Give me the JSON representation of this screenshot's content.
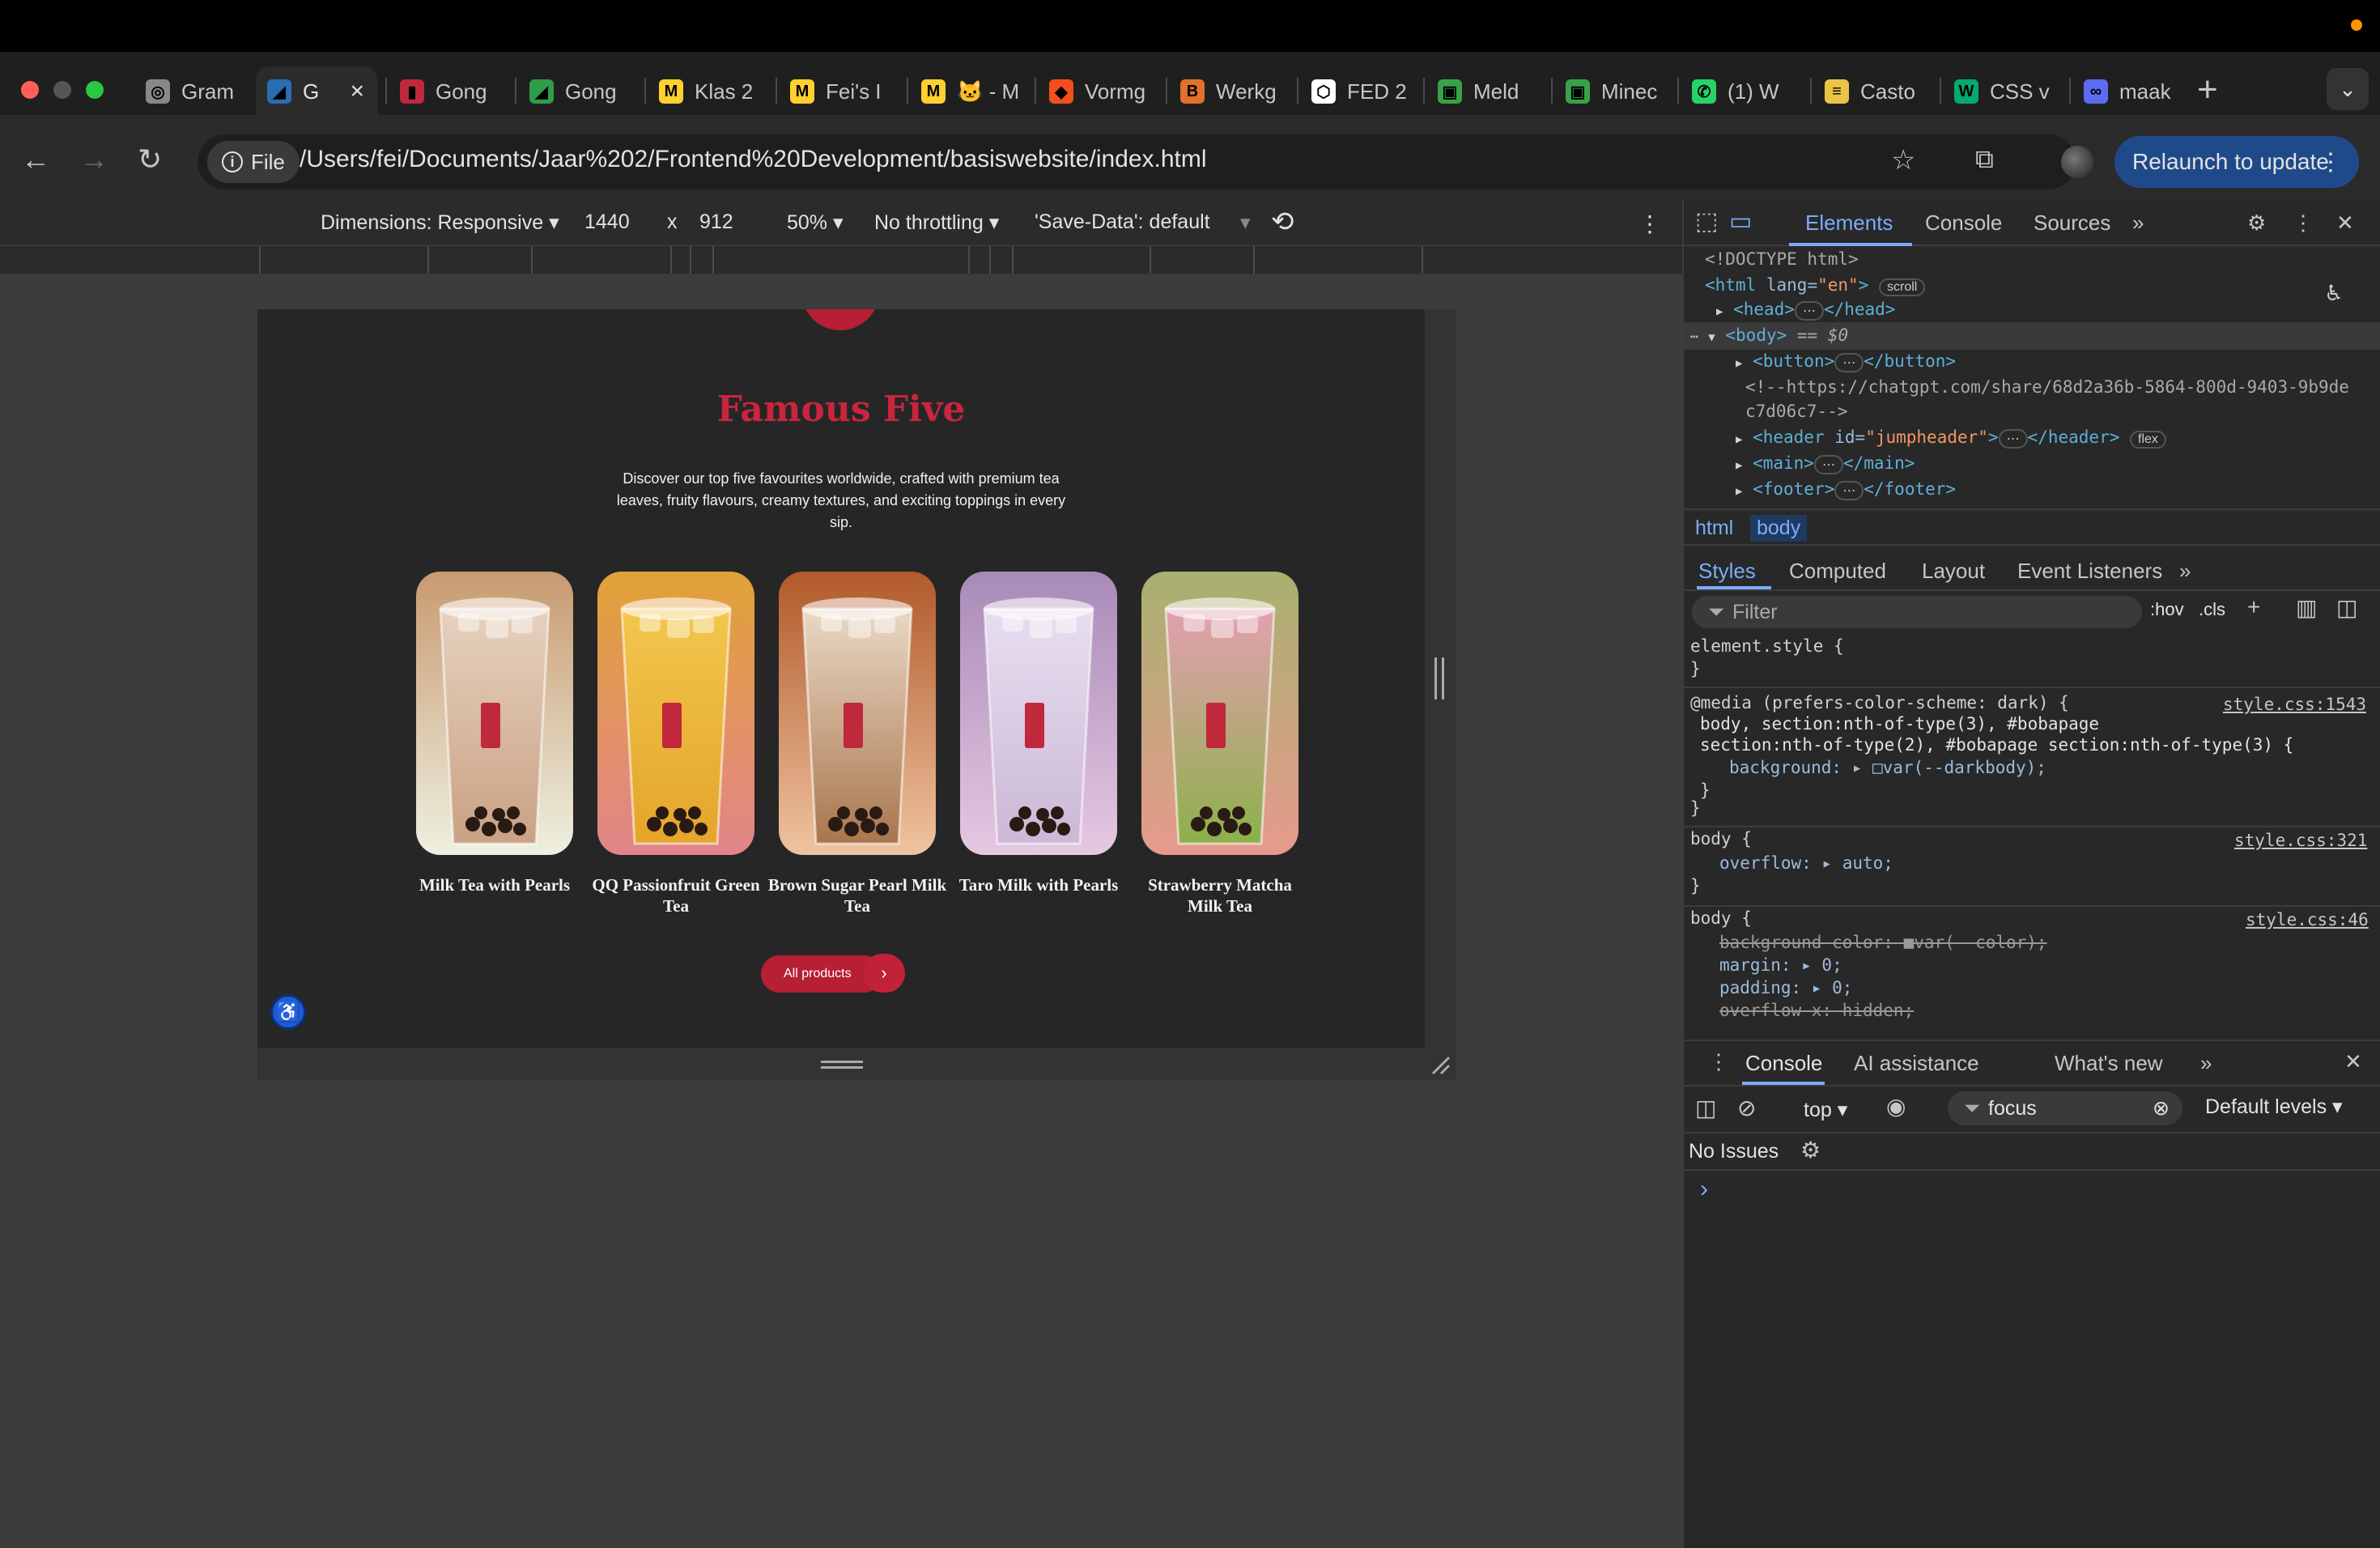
{
  "browser": {
    "tabs": [
      {
        "title": "Gram",
        "favicon": "openai-icon",
        "color": "#888888",
        "glyph": "◎"
      },
      {
        "title": "G",
        "favicon": "site-icon",
        "color": "#2a6db0",
        "glyph": "◢",
        "active": true
      },
      {
        "title": "Gong",
        "favicon": "gongcha-icon",
        "color": "#c0283c",
        "glyph": "▮"
      },
      {
        "title": "Gong",
        "favicon": "site-icon",
        "color": "#2f9c4a",
        "glyph": "◢"
      },
      {
        "title": "Klas 2",
        "favicon": "miro-icon",
        "color": "#ffd02f",
        "glyph": "M"
      },
      {
        "title": "Fei's I",
        "favicon": "miro-icon",
        "color": "#ffd02f",
        "glyph": "M"
      },
      {
        "title": "🐱 - M",
        "favicon": "miro-icon",
        "color": "#ffd02f",
        "glyph": "M"
      },
      {
        "title": "Vormg",
        "favicon": "figma-icon",
        "color": "#f24e1e",
        "glyph": "◆"
      },
      {
        "title": "Werkg",
        "favicon": "brave-icon",
        "color": "#e0702a",
        "glyph": "B"
      },
      {
        "title": "FED 2",
        "favicon": "codepen-icon",
        "color": "#ffffff",
        "glyph": "⬡"
      },
      {
        "title": "Meld",
        "favicon": "minecraft-icon",
        "color": "#3aa14a",
        "glyph": "▣"
      },
      {
        "title": "Minec",
        "favicon": "minecraft-icon",
        "color": "#3aa14a",
        "glyph": "▣"
      },
      {
        "title": "(1) W",
        "favicon": "whatsapp-icon",
        "color": "#25d366",
        "glyph": "✆"
      },
      {
        "title": "Casto",
        "favicon": "castor-icon",
        "color": "#e8c547",
        "glyph": "≡"
      },
      {
        "title": "CSS v",
        "favicon": "w3-icon",
        "color": "#04aa6d",
        "glyph": "W"
      },
      {
        "title": "maak",
        "favicon": "app-icon",
        "color": "#5b6cf0",
        "glyph": "∞"
      }
    ],
    "new_tab": "+",
    "tab_search": "⌄",
    "chip_label": "File",
    "url": "/Users/fei/Documents/Jaar%202/Frontend%20Development/basiswebsite/index.html",
    "relaunch_label": "Relaunch to update"
  },
  "device_toolbar": {
    "dimensions": "Dimensions: Responsive ▾",
    "width": "1440",
    "times": "x",
    "height": "912",
    "zoom": "50% ▾",
    "throttle": "No throttling ▾",
    "save_data": "'Save-Data': default",
    "save_data_arrow": "▾"
  },
  "page": {
    "title": "Famous Five",
    "description": "Discover our top five favourites worldwide, crafted with premium tea leaves, fruity flavours, creamy textures, and exciting toppings in every sip.",
    "products": [
      {
        "name": "Milk Tea with Pearls",
        "bg_top": "#c89a70",
        "bg_bottom": "#eef0e0",
        "drink": "#c9a184",
        "drink_light": "#e6d2be"
      },
      {
        "name": "QQ Passionfruit Green Tea",
        "bg_top": "#e1a236",
        "bg_bottom": "#e2858a",
        "drink": "#e4a52a",
        "drink_light": "#f2c64e"
      },
      {
        "name": "Brown Sugar Pearl Milk Tea",
        "bg_top": "#b15a2a",
        "bg_bottom": "#efc3a0",
        "drink": "#a8764e",
        "drink_light": "#ead8c4"
      },
      {
        "name": "Taro Milk with Pearls",
        "bg_top": "#a88ab8",
        "bg_bottom": "#e6c8e2",
        "drink": "#cbb8d6",
        "drink_light": "#e8def0"
      },
      {
        "name": "Strawberry Matcha Milk Tea",
        "bg_top": "#a8b070",
        "bg_bottom": "#e69a8c",
        "drink": "#8cb04a",
        "drink_light": "#e4a0b0"
      }
    ],
    "all_products_label": "All products",
    "arrow": "›"
  },
  "devtools": {
    "tabs": [
      "Elements",
      "Console",
      "Sources"
    ],
    "more": "»",
    "dom": {
      "doctype": "<!DOCTYPE html>",
      "html_open": "<html",
      "html_attr": "lang=",
      "html_val": "\"en\"",
      "html_close": ">",
      "scroll_pill": "scroll",
      "head": "<head>",
      "head_close": "</head>",
      "body_open": "<body>",
      "body_eq": "== $0",
      "button_open": "<button>",
      "button_close": "</button>",
      "comment_1": "<!--https://chatgpt.com/share/68d2a36b-5864-800d-9403-9b9de",
      "comment_2": "c7d06c7-->",
      "header_open": "<header",
      "header_attr": "id=",
      "header_val": "\"jumpheader\"",
      "header_mid": ">",
      "header_close": "</header>",
      "flex_pill": "flex",
      "main_open": "<main>",
      "main_close": "</main>",
      "footer_open": "<footer>",
      "footer_close": "</footer>",
      "ellipsis": "⋯"
    },
    "breadcrumbs": [
      "html",
      "body"
    ],
    "subtabs": [
      "Styles",
      "Computed",
      "Layout",
      "Event Listeners"
    ],
    "filter_placeholder": "Filter",
    "hov": ":hov",
    "cls": ".cls",
    "styles": {
      "element_style": "element.style {",
      "close": "}",
      "media": "@media (prefers-color-scheme: dark) {",
      "media_src": "style.css:1543",
      "media_sel_1": "body, section:nth-of-type(3), #bobapage",
      "media_sel_2": "section:nth-of-type(2), #bobapage section:nth-of-type(3) {",
      "media_prop": "background: ▸ □var(--darkbody);",
      "rule2_sel": "body {",
      "rule2_src": "style.css:321",
      "rule2_prop": "overflow: ▸ auto;",
      "rule3_sel": "body {",
      "rule3_src": "style.css:46",
      "rule3_p1": "background-color: ■var(--color);",
      "rule3_p2": "margin: ▸ 0;",
      "rule3_p3": "padding: ▸ 0;",
      "rule3_p4": "overflow-x: hidden;"
    },
    "drawer_tabs": [
      "Console",
      "AI assistance",
      "What's new"
    ],
    "context": "top ▾",
    "focus_filter": "focus",
    "levels": "Default levels ▾",
    "no_issues": "No Issues",
    "prompt": "›"
  }
}
